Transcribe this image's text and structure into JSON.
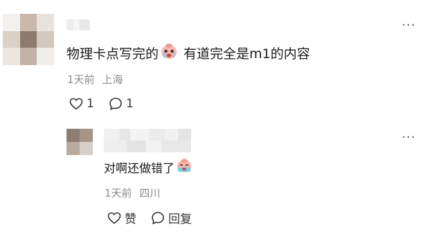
{
  "main_comment": {
    "text_before": "物理卡点写完的",
    "emoji_icon": "crying-face-emoji",
    "text_after": "有道完全是m1的内容",
    "time": "1天前",
    "location": "上海",
    "like_count": "1",
    "comment_count": "1",
    "more_label": "···"
  },
  "reply": {
    "text": "对啊还做错了",
    "emoji_icon": "crying-face-emoji",
    "time": "1天前",
    "location": "四川",
    "like_label": "赞",
    "reply_label": "回复",
    "more_label": "···"
  },
  "colors": {
    "text": "#1a1a1a",
    "meta": "#8a8a8a",
    "icon": "#333333"
  }
}
